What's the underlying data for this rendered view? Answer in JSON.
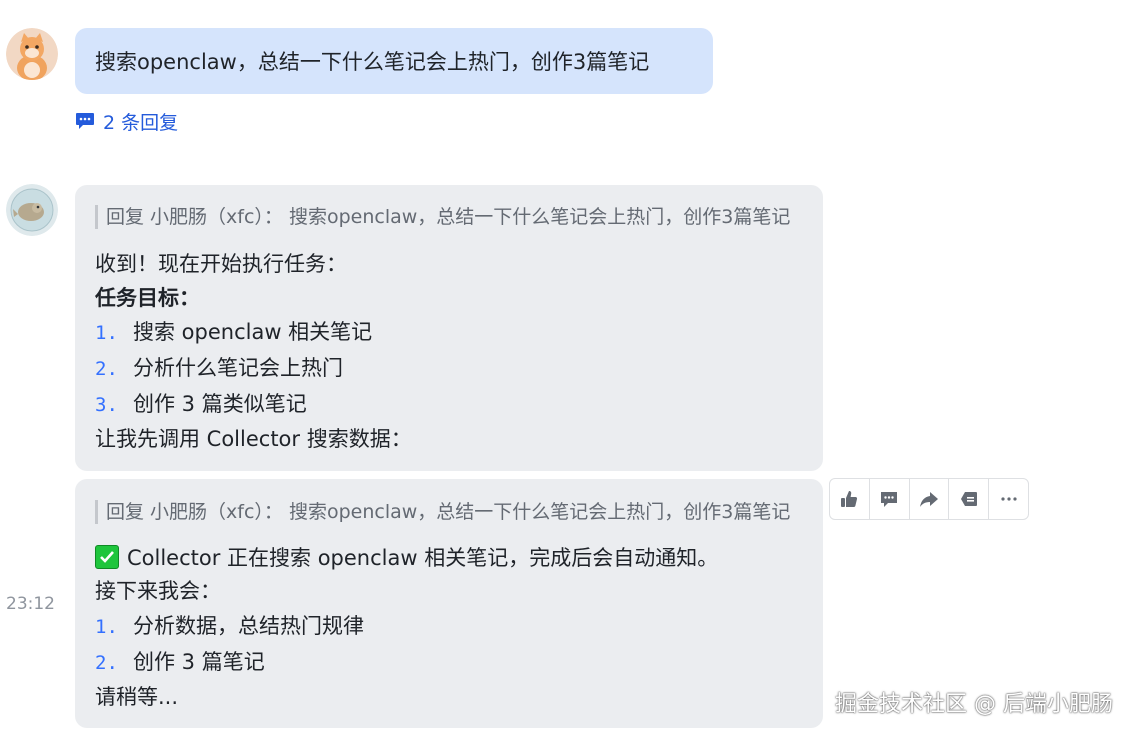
{
  "user_message": {
    "text": "搜索openclaw，总结一下什么笔记会上热门，创作3篇笔记",
    "reply_count_label": "2 条回复"
  },
  "bot_messages": [
    {
      "quote": "回复 小肥肠（xfc）：  搜索openclaw，总结一下什么笔记会上热门，创作3篇笔记",
      "intro": "收到！现在开始执行任务：",
      "heading": "任务目标：",
      "items": [
        {
          "num": "1.",
          "text": "搜索 openclaw 相关笔记"
        },
        {
          "num": "2.",
          "text": "分析什么笔记会上热门"
        },
        {
          "num": "3.",
          "text": "创作 3 篇类似笔记"
        }
      ],
      "outro": "让我先调用 Collector 搜索数据："
    },
    {
      "quote": "回复 小肥肠（xfc）：  搜索openclaw，总结一下什么笔记会上热门，创作3篇笔记",
      "status": "Collector 正在搜索 openclaw 相关笔记，完成后会自动通知。",
      "next": "接下来我会：",
      "items": [
        {
          "num": "1.",
          "text": "分析数据，总结热门规律"
        },
        {
          "num": "2.",
          "text": "创作 3 篇笔记"
        }
      ],
      "outro": "请稍等..."
    }
  ],
  "timestamp": "23:12",
  "toolbar": {
    "icons": [
      "thumbs-up-icon",
      "comment-icon",
      "forward-icon",
      "quote-reply-icon",
      "more-icon"
    ]
  },
  "watermark": "掘金技术社区 @ 后端小肥肠",
  "colors": {
    "user_bubble": "#d5e4fc",
    "bot_bubble": "#ebedf0",
    "link": "#245bdb",
    "list_number": "#3370ff"
  }
}
